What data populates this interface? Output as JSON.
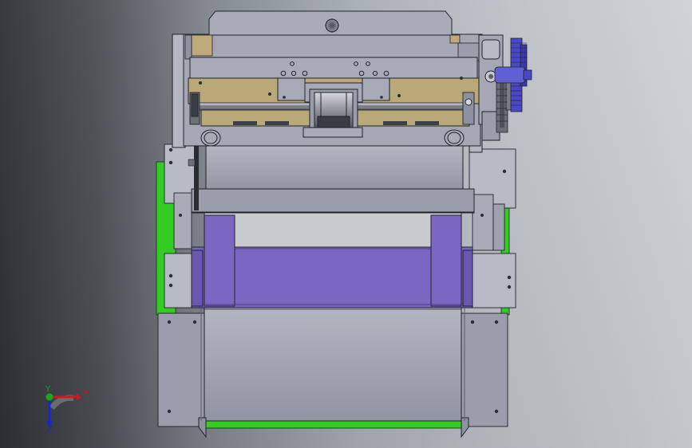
{
  "scene": {
    "colors": {
      "sheet_metal": "#9699a6",
      "sheet_metal_light": "#a9acb8",
      "outline": "#202228",
      "green_base": "#33cc22",
      "purple_guide": "#7b66c2",
      "purple_dark": "#5f4ea6",
      "tan_plate": "#b9a878",
      "gear_blue": "#4a48c4",
      "roller_dark": "#3c3e46"
    }
  },
  "triad": {
    "x_label": "X",
    "y_label": "Y",
    "z_label": "Z",
    "x_color": "#d01818",
    "y_color": "#18a818",
    "z_color": "#1828d0"
  }
}
